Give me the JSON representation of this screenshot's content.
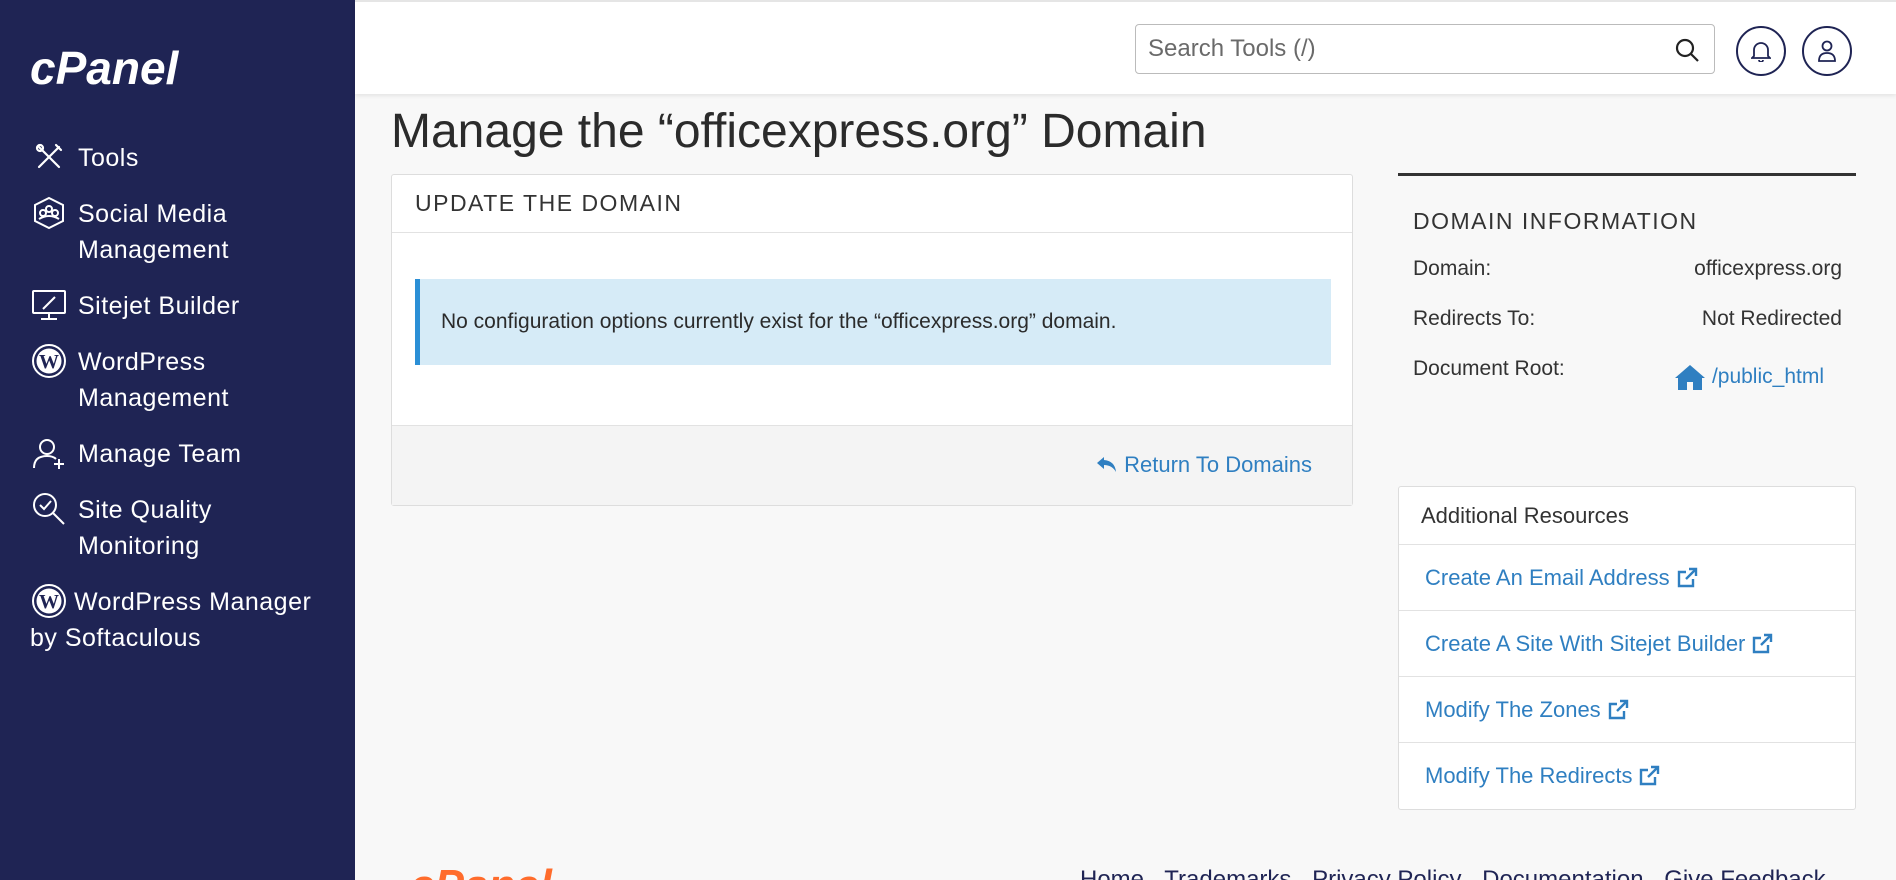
{
  "app": {
    "logo_text": "cPanel"
  },
  "sidebar": {
    "items": [
      {
        "label": "Tools",
        "icon": "tools-icon"
      },
      {
        "label": "Social Media Management",
        "icon": "social-media-icon"
      },
      {
        "label": "Sitejet Builder",
        "icon": "sitejet-monitor-icon"
      },
      {
        "label": "WordPress Management",
        "icon": "wordpress-icon"
      },
      {
        "label": "Manage Team",
        "icon": "manage-team-icon"
      },
      {
        "label": "Site Quality Monitoring",
        "icon": "site-quality-icon"
      },
      {
        "label": "WordPress Manager by Softaculous",
        "icon": "wordpress-icon"
      }
    ]
  },
  "topbar": {
    "search_placeholder": "Search Tools (/)",
    "search_icon": "search-icon",
    "notifications_icon": "bell-icon",
    "user_icon": "user-icon"
  },
  "page": {
    "title": "Manage the “officexpress.org” Domain"
  },
  "update_panel": {
    "header": "UPDATE THE DOMAIN",
    "alert": "No configuration options currently exist for the “officexpress.org” domain.",
    "return_link": "Return To Domains"
  },
  "domain_info": {
    "title": "DOMAIN INFORMATION",
    "domain_label": "Domain:",
    "domain_value": "officexpress.org",
    "redirects_label": "Redirects To:",
    "redirects_value": "Not Redirected",
    "docroot_label": "Document Root:",
    "docroot_value": "/public_html"
  },
  "resources": {
    "title": "Additional Resources",
    "items": [
      "Create An Email Address",
      "Create A Site With Sitejet Builder",
      "Modify The Zones",
      "Modify The Redirects"
    ]
  },
  "footer": {
    "links": [
      "Home",
      "Trademarks",
      "Privacy Policy",
      "Documentation",
      "Give Feedback"
    ]
  },
  "colors": {
    "sidebar_bg": "#1f2454",
    "link": "#2f7fc1",
    "alert_bg": "#d6ebf7",
    "alert_border": "#2b8fd6",
    "brand_orange": "#ff6c2c"
  }
}
